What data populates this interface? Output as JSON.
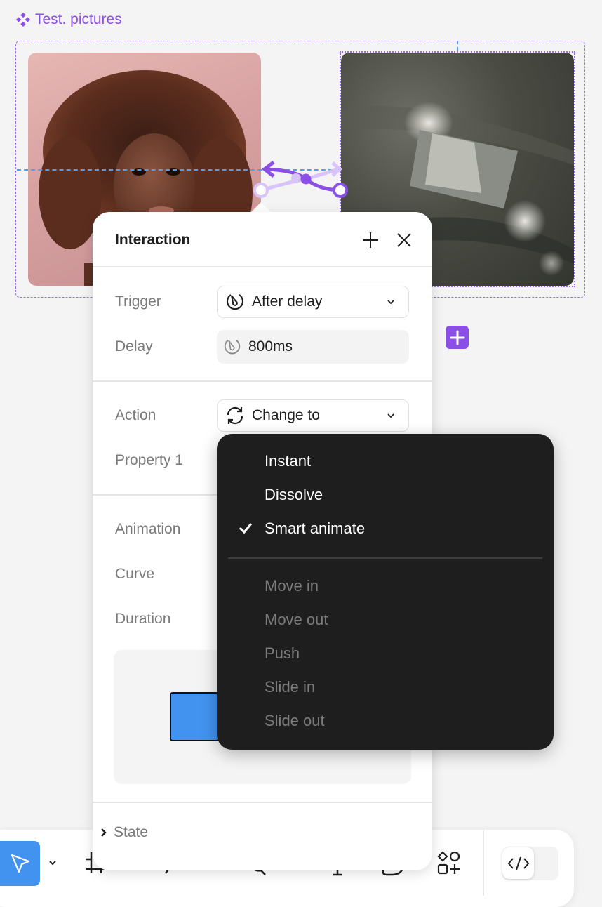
{
  "canvas": {
    "component_label": "Test. pictures",
    "component_icon": "component-set-icon",
    "variants": [
      {
        "name": "portrait-photo",
        "description": "Woman with curly hair on pink background"
      },
      {
        "name": "card-on-fabric-photo",
        "description": "Blank card on grey fabric with light spots"
      }
    ],
    "add_variant_icon": "plus-icon"
  },
  "colors": {
    "accent_purple": "#8b4fe8",
    "guide_blue": "#4ba0f5",
    "tool_active_blue": "#4293f0",
    "menu_bg": "#1e1e1e"
  },
  "interaction_panel": {
    "title": "Interaction",
    "add_icon": "plus-icon",
    "close_icon": "close-icon",
    "trigger": {
      "label": "Trigger",
      "value": "After delay",
      "icon": "timer-icon"
    },
    "delay": {
      "label": "Delay",
      "value": "800ms",
      "icon": "timer-icon"
    },
    "action": {
      "label": "Action",
      "value": "Change to",
      "icon": "refresh-icon"
    },
    "property": {
      "label": "Property 1"
    },
    "animation": {
      "label": "Animation"
    },
    "curve": {
      "label": "Curve"
    },
    "duration": {
      "label": "Duration"
    },
    "state": {
      "label": "State",
      "icon": "chevron-right-icon"
    }
  },
  "animation_menu": {
    "selected": "Smart animate",
    "items": [
      {
        "label": "Instant",
        "enabled": true,
        "checked": false
      },
      {
        "label": "Dissolve",
        "enabled": true,
        "checked": false
      },
      {
        "label": "Smart animate",
        "enabled": true,
        "checked": true
      },
      {
        "label": "Move in",
        "enabled": false,
        "checked": false
      },
      {
        "label": "Move out",
        "enabled": false,
        "checked": false
      },
      {
        "label": "Push",
        "enabled": false,
        "checked": false
      },
      {
        "label": "Slide in",
        "enabled": false,
        "checked": false
      },
      {
        "label": "Slide out",
        "enabled": false,
        "checked": false
      }
    ]
  },
  "toolbar": {
    "tools": [
      "move",
      "frame",
      "pen",
      "comment",
      "text",
      "shape",
      "actions"
    ],
    "active_tool": "move",
    "dev_mode_icon": "code-icon"
  }
}
